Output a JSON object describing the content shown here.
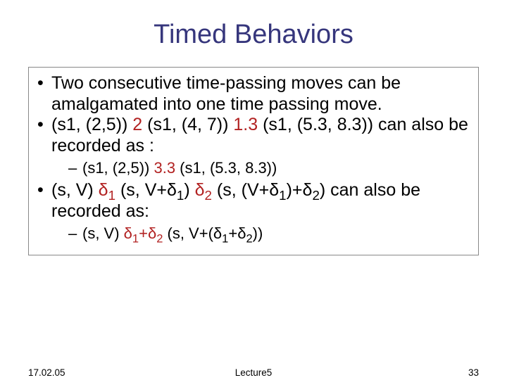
{
  "title": "Timed Behaviors",
  "bullets": {
    "b1": "Two consecutive time-passing moves can be amalgamated into one time passing move.",
    "b2_a": "(s1, (2,5)) ",
    "b2_r1": "2",
    "b2_b": " (s1, (4, 7)) ",
    "b2_r2": "1.3",
    "b2_c": " (s1, (5.3, 8.3)) can also be recorded as :",
    "s1_a": "(s1, (2,5)) ",
    "s1_r": "3.3",
    "s1_b": " (s1, (5.3, 8.3))",
    "b3_a": "(s, V) ",
    "b3_r1_pre": "δ",
    "b3_r1_sub": "1",
    "b3_b": " (s, V+δ",
    "b3_b_sub": "1",
    "b3_c": ") ",
    "b3_r2_pre": "δ",
    "b3_r2_sub": "2",
    "b3_d": " (s, (V+δ",
    "b3_d_sub1": "1",
    "b3_e": ")+δ",
    "b3_e_sub": "2",
    "b3_f": ") can also be recorded as:",
    "s2_a": "(s, V) ",
    "s2_r_pre": "δ",
    "s2_r_sub1": "1",
    "s2_r_plus": "+δ",
    "s2_r_sub2": "2",
    "s2_b": " (s, V+(δ",
    "s2_b_sub1": "1",
    "s2_c": "+δ",
    "s2_c_sub": "2",
    "s2_d": "))"
  },
  "footer": {
    "date": "17.02.05",
    "lecture": "Lecture5",
    "page": "33"
  }
}
